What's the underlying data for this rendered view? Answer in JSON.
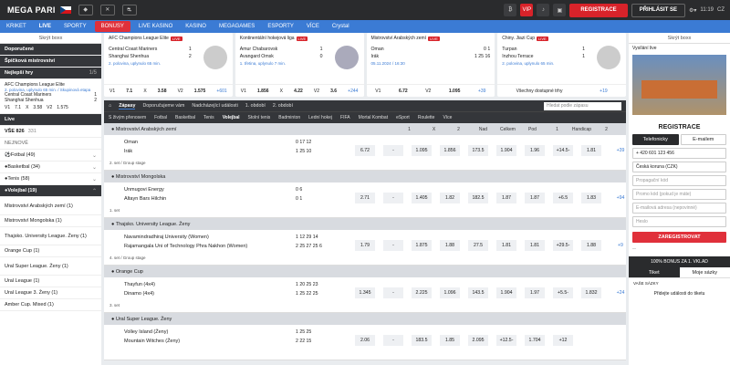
{
  "header": {
    "logo": "MEGA PARI",
    "vip": "VIP",
    "register": "REGISTRACE",
    "login": "PŘIHLÁSIT SE",
    "time": "11:19",
    "lang": "CZ"
  },
  "nav": [
    "KRIKET",
    "LIVE",
    "SPORTY",
    "BONUSY",
    "LIVE KASINO",
    "KASINO",
    "MEGAGAMES",
    "ESPORTY",
    "VÍCE",
    "Crystal"
  ],
  "left": {
    "hide": "Skrýt boxx",
    "items": [
      "Doporučené",
      "Špičková mistrovství"
    ],
    "fav": "Nejlepší hry",
    "fav_page": "1/5",
    "league": "AFC Champions League Elite",
    "league_time": "2. polovina, uplynulo 65 min. / Skupinová etapa",
    "t1": "Central Coast Mariners",
    "t2": "Shanghai Shenhua",
    "s1": "1",
    "s2": "2",
    "o1": "V1",
    "o2": "7.1",
    "o3": "X",
    "o4": "3.58",
    "o5": "V2",
    "o6": "1.575",
    "live": "Live",
    "all": "VŠE 826",
    "all_count": "331",
    "new": "NEJNOVĚ",
    "sports": [
      "Fotbal (49)",
      "Basketbal (34)",
      "Tenis (58)"
    ],
    "volej": "Volejbal (19)",
    "subs": [
      "Mistrovství Arabských zemí (1)",
      "Mistrovství Mongolska (1)",
      "Thajsko. University League. Ženy (1)",
      "Orange Cup (1)",
      "Ural Super League. Ženy (1)",
      "Ural League (1)",
      "Ural League 3. Ženy (1)",
      "Amber Cup. Mixed (1)"
    ]
  },
  "cards": [
    {
      "league": "AFC Champions League Elite",
      "t1": "Central Coast Mariners",
      "t2": "Shanghai Shenhua",
      "s1": "1",
      "s2": "2",
      "info": "2. polovina, uplynulo 65 min.",
      "o": [
        "V1",
        "7.1",
        "X",
        "3.58",
        "V2",
        "1.575",
        "+601"
      ]
    },
    {
      "league": "Kontinentální hokejová liga",
      "t1": "Amur Chabarovsk",
      "t2": "Avangard Omsk",
      "s1": "1",
      "s2": "0",
      "info": "1. třetina, uplynulo 7 min.",
      "o": [
        "V1",
        "1.856",
        "X",
        "4.22",
        "V2",
        "3.6",
        "+244"
      ]
    },
    {
      "league": "Mistrovství Arabských zemí",
      "t1": "Oman",
      "t2": "Irák",
      "s1": "0 1",
      "s2": "1 25 16",
      "info": "05.11.2024 / 16:30",
      "o": [
        "V1",
        "6.72",
        "V2",
        "1.095",
        "+39"
      ]
    },
    {
      "league": "Chiny. Jiazi Cup",
      "t1": "Turpan",
      "t2": "Inzhou Terrace",
      "s1": "1",
      "s2": "1",
      "info": "2. polovina, uplynulo 65 min.",
      "o": [
        "Všechny dostupné trhy",
        "+19"
      ]
    }
  ],
  "filters": {
    "items": [
      "Zápasy",
      "Doporučujeme vám",
      "Nadcházející události",
      "1. období",
      "2. období"
    ],
    "search": "Hledat podle zápasu"
  },
  "sportbar": [
    "S živým přenosem",
    "Fotbal",
    "Basketbal",
    "Tenis",
    "Volejbal",
    "Stolní tenis",
    "Badminton",
    "Lední hokej",
    "FIFA",
    "Mortal Kombat",
    "eSport",
    "Roulette",
    "Více"
  ],
  "cols": [
    "1",
    "X",
    "2",
    "Nad",
    "Celkem",
    "Pod",
    "1",
    "Handicap",
    "2"
  ],
  "groups": [
    {
      "name": "Mistrovství Arabských zemí",
      "matches": [
        {
          "t1": "Oman",
          "t2": "Irák",
          "a": "0  17  12",
          "b": "1  25  10",
          "info": "2. set / Group stage",
          "o": [
            "6.72",
            "-",
            "1.095",
            "1.856",
            "173.5",
            "1.904",
            "1.96",
            "+14.5-",
            "1.81",
            "+39"
          ]
        }
      ]
    },
    {
      "name": "Mistrovství Mongolska",
      "matches": [
        {
          "t1": "Unmugovi Energy",
          "t2": "Altayn Bars Hilchin",
          "a": "0  6",
          "b": "0  1",
          "info": "1. set",
          "o": [
            "2.71",
            "-",
            "1.405",
            "1.82",
            "182.5",
            "1.87",
            "1.87",
            "+6.5",
            "1.83",
            "+94"
          ]
        }
      ]
    },
    {
      "name": "Thajsko. University League. Ženy",
      "matches": [
        {
          "t1": "Navamindradhiraj University (Women)",
          "t2": "Rajamangala Uni of Technology Phra Nakhon (Women)",
          "a": "1  12  29  14",
          "b": "2  25  27  25  6",
          "info": "4. set / Group stage",
          "o": [
            "1.79",
            "-",
            "1.875",
            "1.88",
            "27.5",
            "1.81",
            "1.81",
            "+29.5-",
            "1.88",
            "+9"
          ]
        }
      ]
    },
    {
      "name": "Orange Cup",
      "matches": [
        {
          "t1": "Thayfun (4x4)",
          "t2": "Dinamo (4x4)",
          "a": "1  20  25  23",
          "b": "1  25  22  25",
          "info": "3. set",
          "o": [
            "1.345",
            "-",
            "2.225",
            "1.096",
            "143.5",
            "1.904",
            "1.97",
            "+5.5-",
            "1.832",
            "+24"
          ]
        }
      ]
    },
    {
      "name": "Ural Super League. Ženy",
      "matches": [
        {
          "t1": "Volley Island (Ženy)",
          "t2": "Mountain Witches (Ženy)",
          "a": "1  25  25",
          "b": "2  22  15",
          "info": "",
          "o": [
            "2.06",
            "-",
            "183.5",
            "1.85",
            "2.095",
            "+12.5-",
            "1.704",
            "+12"
          ]
        }
      ]
    }
  ],
  "right": {
    "hide": "Skrýt boxx",
    "video": "Vysílání live",
    "regtitle": "REGISTRACE",
    "tab1": "Telefonicky",
    "tab2": "E-mailem",
    "phone": "+ 420   601 123 456",
    "currency": "Česká koruna (CZK)",
    "promo": "Propagační kód",
    "f1": "Promo kód (pokud je máte)",
    "f2": "E-mailová adresa (nepovinné)",
    "f3": "Heslo",
    "btn": "ZAREGISTROVAT",
    "bonus": "100% BONUS ZA 1. VKLAD",
    "slip1": "Tiket",
    "slip2": "Moje sázky",
    "kind": "VAŠE SÁZKY",
    "add": "Přidejte události do tiketu"
  }
}
